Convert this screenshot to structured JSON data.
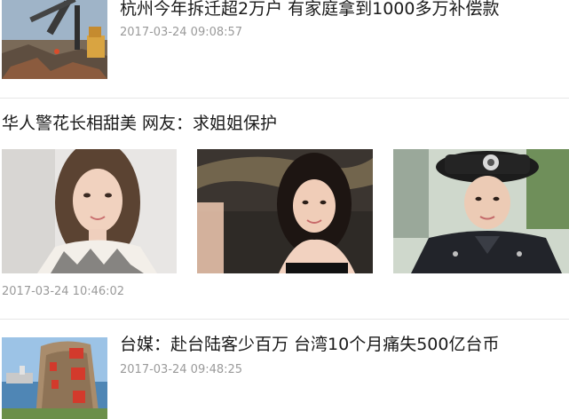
{
  "articles": [
    {
      "title": "杭州今年拆迁超2万户 有家庭拿到1000多万补偿款",
      "time": "2017-03-24 09:08:57",
      "image": "demolition-excavator-photo"
    },
    {
      "title": "华人警花长相甜美 网友：求姐姐保护",
      "time": "2017-03-24 10:46:02",
      "images": [
        "selfie-photo-1",
        "selfie-photo-2",
        "police-uniform-photo"
      ]
    },
    {
      "title": "台媒：赴台陆客少百万 台湾10个月痛失500亿台币",
      "time": "2017-03-24 09:48:25",
      "image": "rock-inscription-seaside-photo"
    }
  ]
}
